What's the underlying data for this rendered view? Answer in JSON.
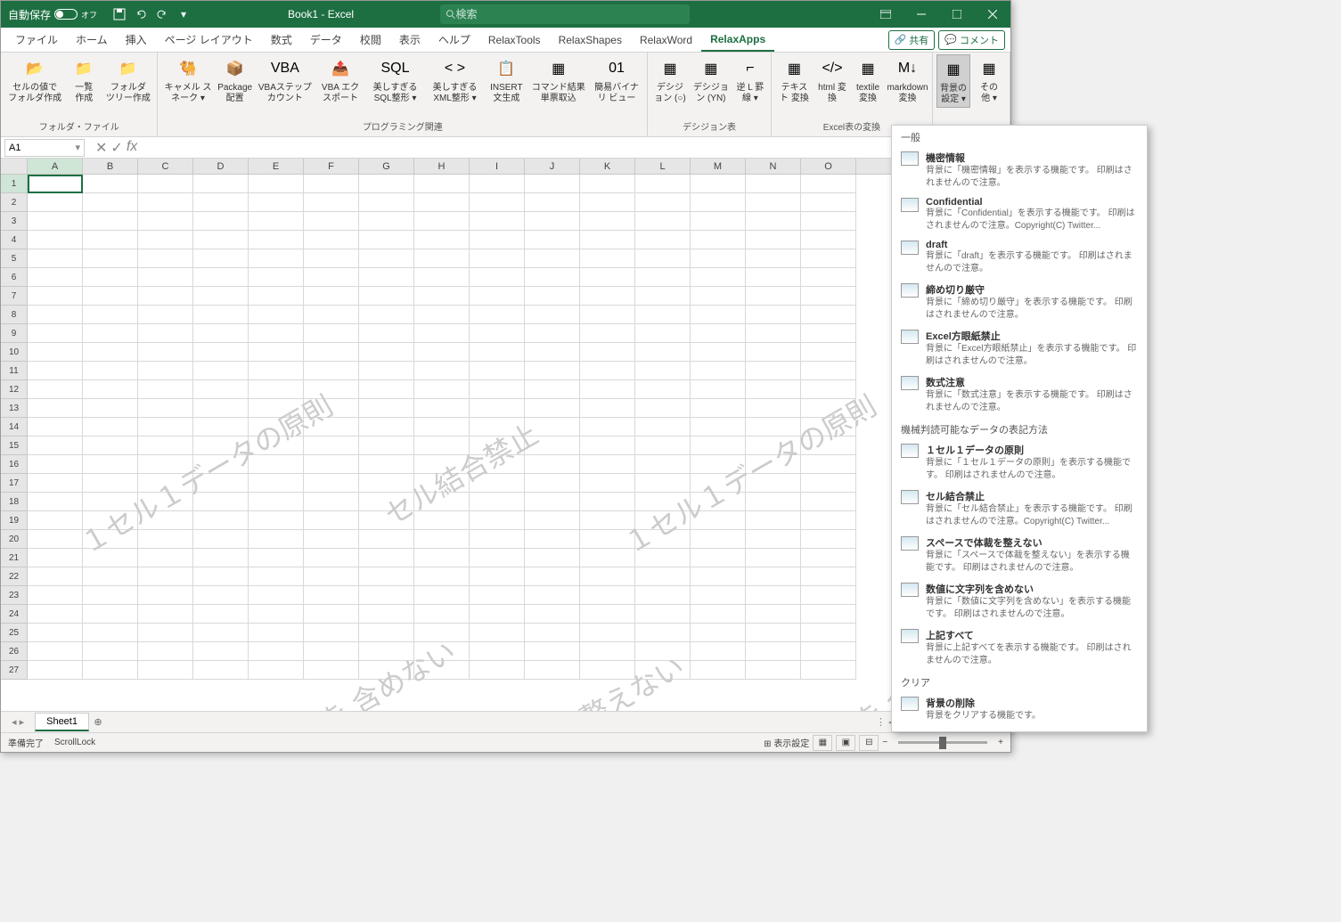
{
  "titlebar": {
    "autosave": "自動保存",
    "autosave_state": "オフ",
    "title": "Book1  -  Excel",
    "search_placeholder": "検索"
  },
  "tabs": {
    "items": [
      "ファイル",
      "ホーム",
      "挿入",
      "ページ レイアウト",
      "数式",
      "データ",
      "校閲",
      "表示",
      "ヘルプ",
      "RelaxTools",
      "RelaxShapes",
      "RelaxWord",
      "RelaxApps"
    ],
    "active": "RelaxApps",
    "share": "共有",
    "comment": "コメント"
  },
  "ribbon": {
    "groups": [
      {
        "label": "フォルダ・ファイル",
        "items": [
          {
            "label": "セルの値で\nフォルダ作成",
            "icon": "folder-open"
          },
          {
            "label": "一覧\n作成",
            "icon": "folder-list"
          },
          {
            "label": "フォルダ\nツリー作成",
            "icon": "folder-tree"
          }
        ]
      },
      {
        "label": "プログラミング関連",
        "items": [
          {
            "label": "キャメル\nスネーク ▾",
            "icon": "camel"
          },
          {
            "label": "Package\n配置",
            "icon": "package"
          },
          {
            "label": "VBAステップ\nカウント",
            "icon": "vba"
          },
          {
            "label": "VBA\nエクスポート",
            "icon": "vba-export"
          },
          {
            "label": "美しすぎる\nSQL整形 ▾",
            "icon": "sql"
          },
          {
            "label": "美しすぎる\nXML整形 ▾",
            "icon": "xml"
          },
          {
            "label": "INSERT\n文生成",
            "icon": "insert"
          },
          {
            "label": "コマンド結果\n単票取込",
            "icon": "cmd"
          },
          {
            "label": "簡易バイナリ\nビュー",
            "icon": "binary"
          }
        ]
      },
      {
        "label": "デシジョン表",
        "items": [
          {
            "label": "デシジョン\n(○)",
            "icon": "dec-o"
          },
          {
            "label": "デシジョン\n(YN)",
            "icon": "dec-yn"
          },
          {
            "label": "逆 L\n罫線 ▾",
            "icon": "l-border"
          }
        ]
      },
      {
        "label": "Excel表の変換",
        "items": [
          {
            "label": "テキスト\n変換",
            "icon": "text"
          },
          {
            "label": "html\n変換",
            "icon": "html"
          },
          {
            "label": "textile\n変換",
            "icon": "textile"
          },
          {
            "label": "markdown\n変換",
            "icon": "markdown"
          }
        ]
      },
      {
        "label": "",
        "items": [
          {
            "label": "背景の\n設定 ▾",
            "icon": "bg",
            "active": true
          },
          {
            "label": "その\n他 ▾",
            "icon": "other"
          }
        ]
      }
    ]
  },
  "formula": {
    "name_box": "A1"
  },
  "columns": [
    "A",
    "B",
    "C",
    "D",
    "E",
    "F",
    "G",
    "H",
    "I",
    "J",
    "K",
    "L",
    "M",
    "N",
    "O"
  ],
  "rows": 27,
  "watermarks": [
    "１セル１データの原則",
    "セル結合禁止",
    "１セル１データの原則",
    "数値データに文字列を\n含めない",
    "スペースで体裁を\n整えない",
    "数値データに文字列を\n含めない"
  ],
  "sheet": {
    "name": "Sheet1"
  },
  "status": {
    "ready": "準備完了",
    "scroll": "ScrollLock",
    "display": "表示設定"
  },
  "dropdown": {
    "section1": "一般",
    "items1": [
      {
        "title": "機密情報",
        "desc": "背景に「機密情報」を表示する機能です。\n印刷はされませんので注意。"
      },
      {
        "title": "Confidential",
        "desc": "背景に「Confidential」を表示する機能です。\n印刷はされませんので注意。Copyright(C) Twitter..."
      },
      {
        "title": "draft",
        "desc": "背景に「draft」を表示する機能です。\n印刷はされませんので注意。"
      },
      {
        "title": "締め切り厳守",
        "desc": "背景に「締め切り厳守」を表示する機能です。\n印刷はされませんので注意。"
      },
      {
        "title": "Excel方眼紙禁止",
        "desc": "背景に「Excel方眼紙禁止」を表示する機能です。\n印刷はされませんので注意。"
      },
      {
        "title": "数式注意",
        "desc": "背景に「数式注意」を表示する機能です。\n印刷はされませんので注意。"
      }
    ],
    "section2": "機械判読可能なデータの表記方法",
    "items2": [
      {
        "title": "１セル１データの原則",
        "desc": "背景に「１セル１データの原則」を表示する機能です。\n印刷はされませんので注意。"
      },
      {
        "title": "セル結合禁止",
        "desc": "背景に「セル結合禁止」を表示する機能です。\n印刷はされませんので注意。Copyright(C) Twitter..."
      },
      {
        "title": "スペースで体裁を整えない",
        "desc": "背景に「スペースで体裁を整えない」を表示する機能です。\n印刷はされませんので注意。"
      },
      {
        "title": "数値に文字列を含めない",
        "desc": "背景に「数値に文字列を含めない」を表示する機能です。\n印刷はされませんので注意。"
      },
      {
        "title": "上記すべて",
        "desc": "背景に上記すべてを表示する機能です。\n印刷はされませんので注意。"
      }
    ],
    "section3": "クリア",
    "items3": [
      {
        "title": "背景の削除",
        "desc": "背景をクリアする機能です。"
      }
    ]
  }
}
